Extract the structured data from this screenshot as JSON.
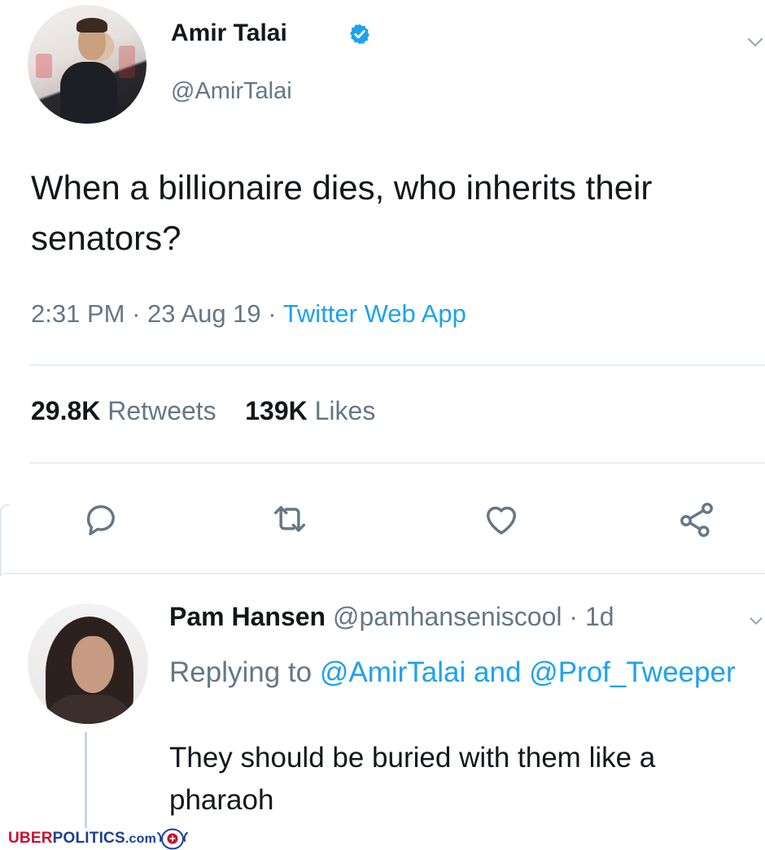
{
  "tweet": {
    "author_name": "Amir Talai",
    "author_handle": "@AmirTalai",
    "verified": true,
    "text": "When a billionaire dies, who inherits their senators?",
    "time": "2:31 PM",
    "date": "23 Aug 19",
    "separator": "·",
    "source": "Twitter Web App",
    "retweets_count": "29.8K",
    "retweets_label": "Retweets",
    "likes_count": "139K",
    "likes_label": "Likes"
  },
  "actions": {
    "icons": [
      "reply-icon",
      "retweet-icon",
      "like-icon",
      "share-icon"
    ]
  },
  "reply": {
    "author_name": "Pam Hansen",
    "author_handle": "@pamhanseniscool",
    "separator": "·",
    "time": "1d",
    "replying_prefix": "Replying to",
    "mention_1": "@AmirTalai",
    "conjunction": "and",
    "mention_2": "@Prof_Tweeper",
    "text": "They should be buried with them like a pharaoh"
  },
  "watermark": {
    "part_1": "UBER",
    "part_2": "POLITICS",
    "part_3": ".com"
  },
  "colors": {
    "accent": "#1da1f2",
    "secondary_text": "#657786",
    "primary_text": "#14171a",
    "watermark_red": "#c8102e",
    "watermark_blue": "#1c3f94"
  }
}
